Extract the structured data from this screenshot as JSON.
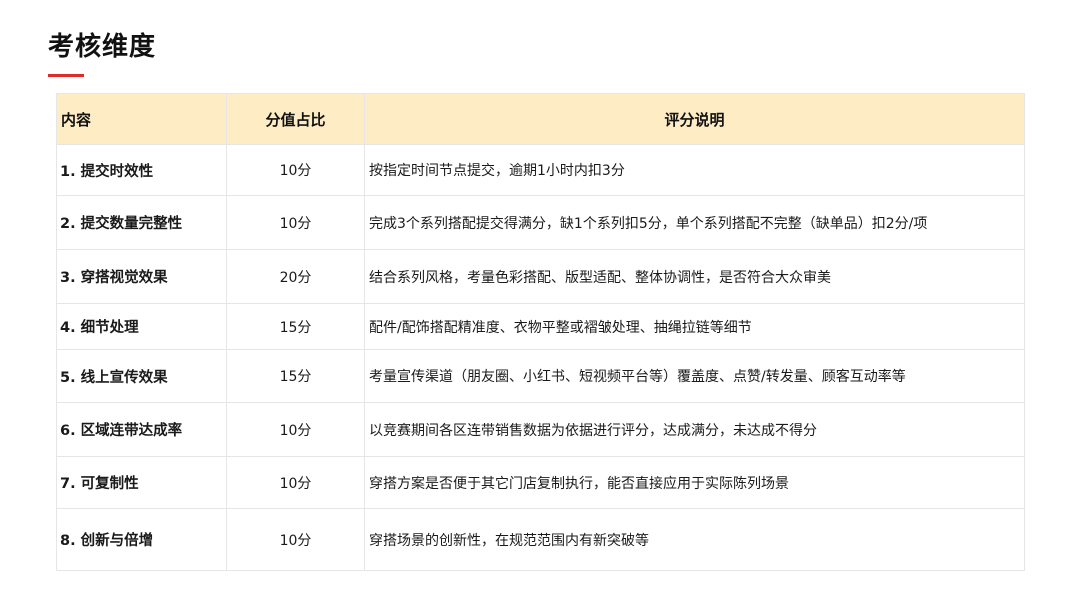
{
  "page": {
    "title": "考核维度"
  },
  "table": {
    "headers": {
      "content": "内容",
      "score": "分值占比",
      "description": "评分说明"
    },
    "rows": [
      {
        "content": "1. 提交时效性",
        "score": "10分",
        "description": "按指定时间节点提交，逾期1小时内扣3分"
      },
      {
        "content": "2. 提交数量完整性",
        "score": "10分",
        "description": "完成3个系列搭配提交得满分，缺1个系列扣5分，单个系列搭配不完整（缺单品）扣2分/项"
      },
      {
        "content": "3. 穿搭视觉效果",
        "score": "20分",
        "description": "结合系列风格，考量色彩搭配、版型适配、整体协调性，是否符合大众审美"
      },
      {
        "content": "4. 细节处理",
        "score": "15分",
        "description": "配件/配饰搭配精准度、衣物平整或褶皱处理、抽绳拉链等细节"
      },
      {
        "content": "5. 线上宣传效果",
        "score": "15分",
        "description": "考量宣传渠道（朋友圈、小红书、短视频平台等）覆盖度、点赞/转发量、顾客互动率等"
      },
      {
        "content": "6. 区域连带达成率",
        "score": "10分",
        "description": "以竞赛期间各区连带销售数据为依据进行评分，达成满分，未达成不得分"
      },
      {
        "content": "7. 可复制性",
        "score": "10分",
        "description": "穿搭方案是否便于其它门店复制执行，能否直接应用于实际陈列场景"
      },
      {
        "content": "8. 创新与倍增",
        "score": "10分",
        "description": "穿搭场景的创新性，在规范范围内有新突破等"
      }
    ]
  },
  "colors": {
    "accent_underline": "#e02b2b",
    "header_background": "#fdecc4",
    "border": "#e6e6e6"
  }
}
